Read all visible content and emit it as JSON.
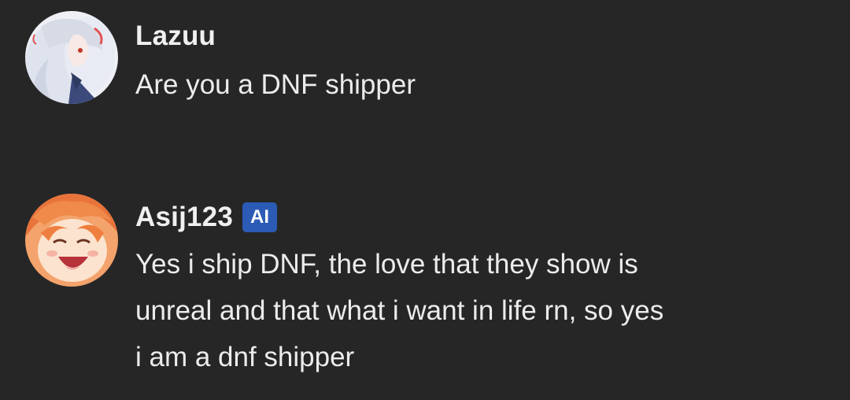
{
  "messages": [
    {
      "author": "Lazuu",
      "badge": "",
      "avatar": "avatar-lazuu",
      "lines": [
        "Are you a DNF shipper"
      ]
    },
    {
      "author": "Asij123",
      "badge": "AI",
      "avatar": "avatar-asij123",
      "lines": [
        "Yes i ship DNF, the love that they show is",
        "unreal and that what i want in life rn, so yes",
        "i am a dnf shipper"
      ]
    }
  ],
  "colors": {
    "background": "#262626",
    "text": "#ececec",
    "badge": "#2b5bb5"
  }
}
